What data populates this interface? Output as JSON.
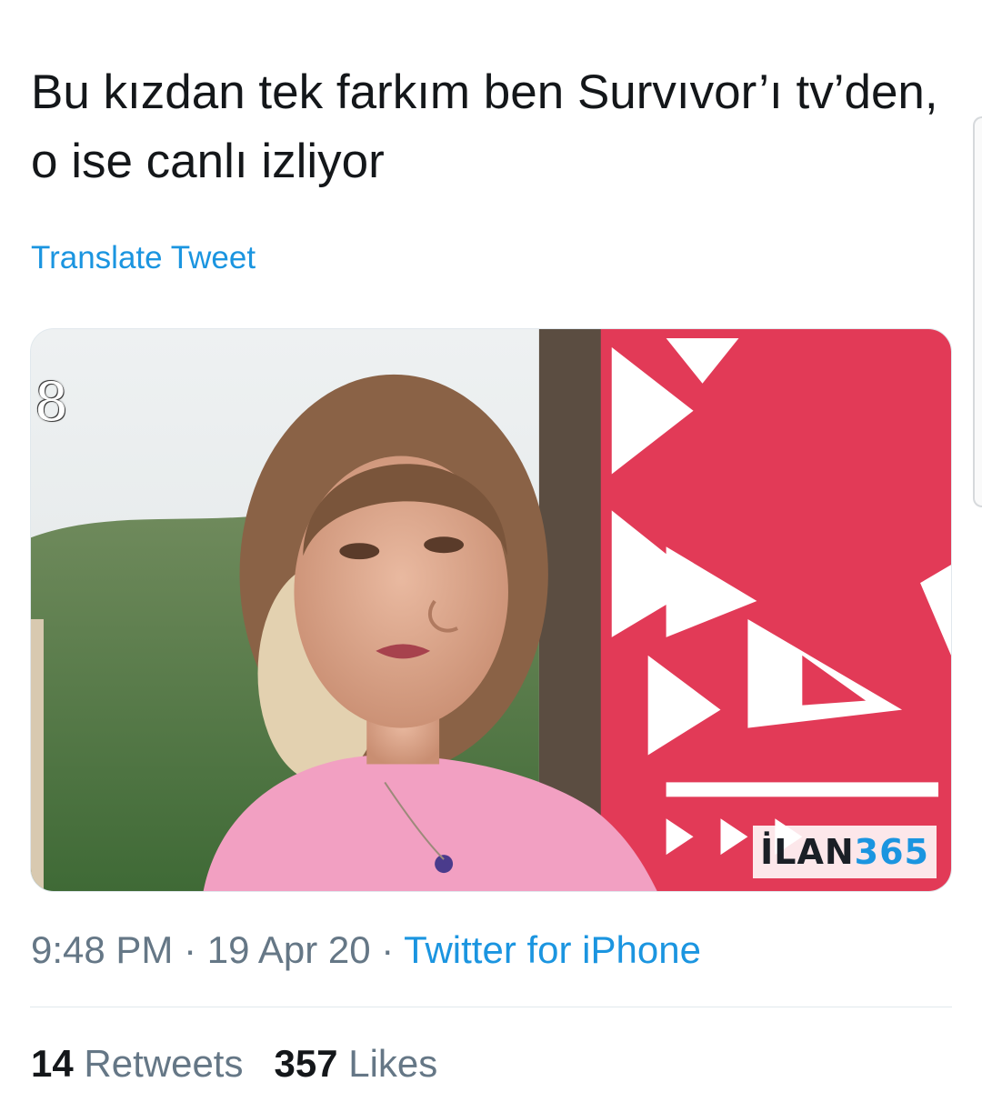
{
  "tweet": {
    "text": "Bu kızdan tek farkım ben Survıvor’ı tv’den, o ise canlı izliyor",
    "translate_label": "Translate Tweet"
  },
  "media": {
    "channel_logo": "8",
    "watermark_prefix": "İLAN",
    "watermark_suffix": "365"
  },
  "meta": {
    "time": "9:48 PM",
    "separator": " · ",
    "date": "19 Apr 20",
    "source": "Twitter for iPhone"
  },
  "stats": {
    "retweets_count": "14",
    "retweets_label": "Retweets",
    "likes_count": "357",
    "likes_label": "Likes"
  },
  "colors": {
    "link": "#1b95e0",
    "text": "#14171a",
    "secondary": "#657786"
  }
}
